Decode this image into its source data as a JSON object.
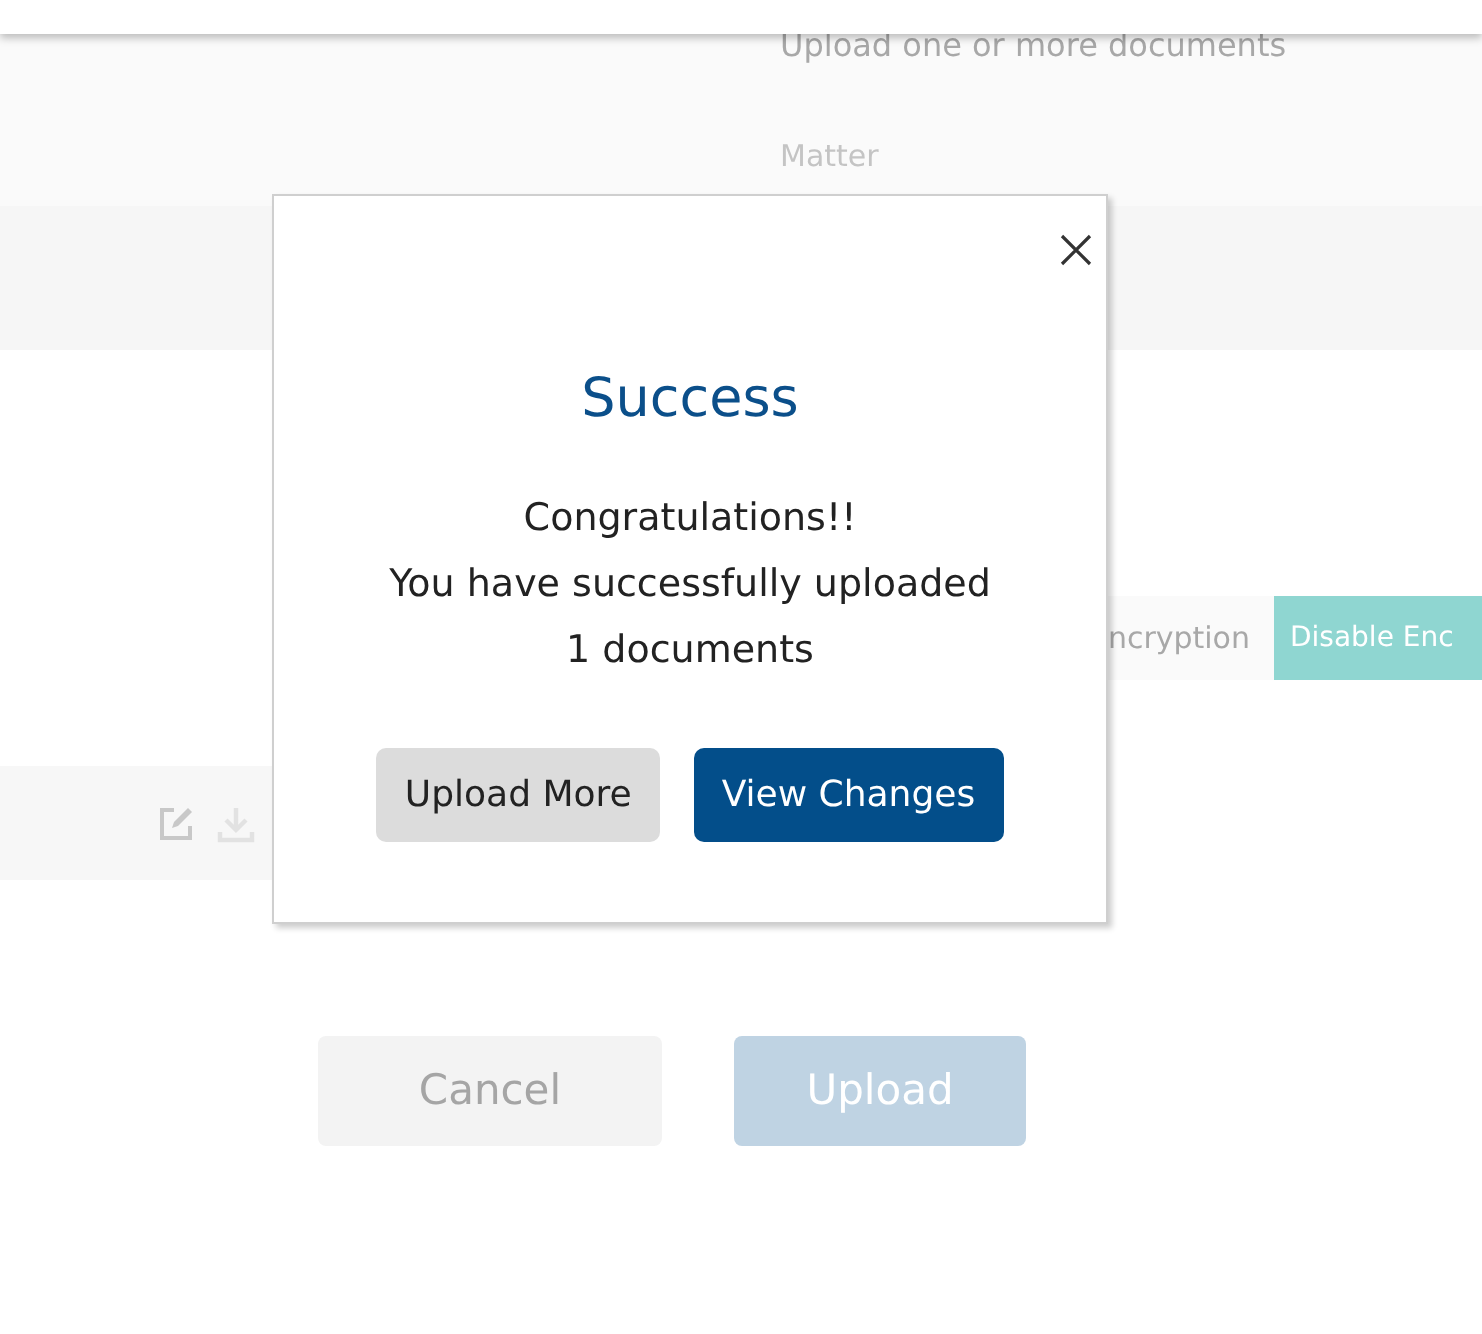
{
  "background": {
    "heading": "Upload one or more documents",
    "field_label": "Matter",
    "encryption_label": "ncryption",
    "encryption_button": "Disable Enc",
    "buttons": [
      {
        "label": "Cancel",
        "kind": "secondary"
      },
      {
        "label": "Upload",
        "kind": "primary"
      }
    ]
  },
  "dialog": {
    "title": "Success",
    "message": [
      "Congratulations!!",
      "You have successfully uploaded",
      "1 documents"
    ],
    "buttons": [
      {
        "label": "Upload More",
        "kind": "secondary"
      },
      {
        "label": "View Changes",
        "kind": "primary"
      }
    ]
  }
}
